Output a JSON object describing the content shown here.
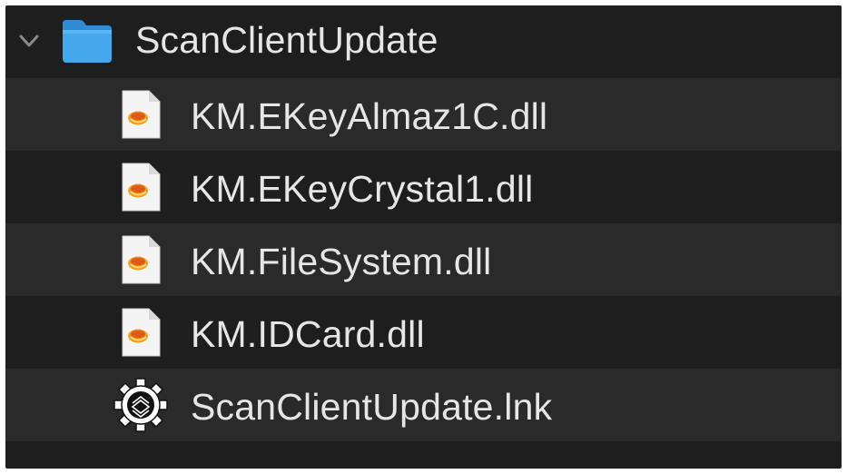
{
  "folder": {
    "name": "ScanClientUpdate",
    "expanded": true,
    "icon": "folder-icon"
  },
  "files": [
    {
      "name": "KM.EKeyAlmaz1C.dll",
      "icon": "dll-file-icon"
    },
    {
      "name": "KM.EKeyCrystal1.dll",
      "icon": "dll-file-icon"
    },
    {
      "name": "KM.FileSystem.dll",
      "icon": "dll-file-icon"
    },
    {
      "name": "KM.IDCard.dll",
      "icon": "dll-file-icon"
    },
    {
      "name": "ScanClientUpdate.lnk",
      "icon": "gear-shortcut-icon"
    }
  ],
  "colors": {
    "background": "#1e1e1e",
    "alternate_row": "#2a2a2a",
    "text": "#e6e6e6",
    "folder_blue": "#45a7ec"
  }
}
